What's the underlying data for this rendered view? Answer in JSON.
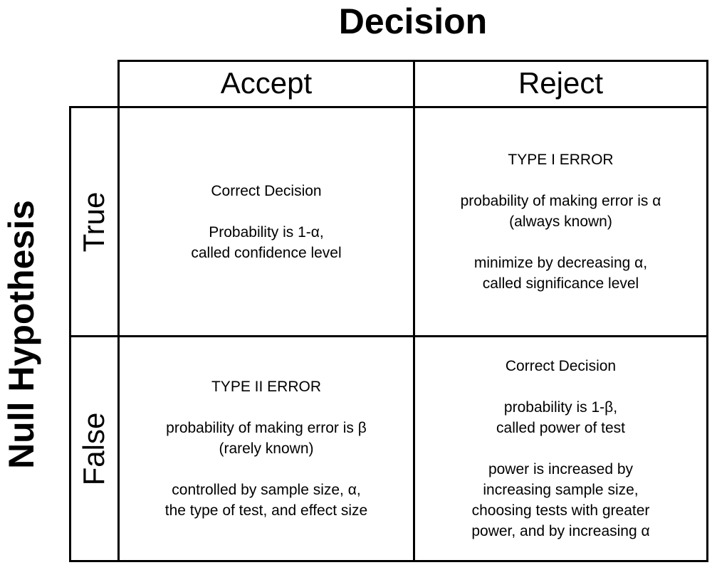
{
  "title_top": "Decision",
  "title_side": "Null Hypothesis",
  "columns": [
    "Accept",
    "Reject"
  ],
  "rows": [
    "True",
    "False"
  ],
  "cells": {
    "true_accept": {
      "heading": "Correct Decision",
      "lines": [
        "Probability is 1-α,",
        "called confidence level"
      ]
    },
    "true_reject": {
      "heading": "TYPE I ERROR",
      "lines": [
        "probability of making error is α",
        "(always known)"
      ],
      "lines2": [
        "minimize by decreasing α,",
        "called significance level"
      ]
    },
    "false_accept": {
      "heading": "TYPE II ERROR",
      "lines": [
        "probability of making error is β",
        "(rarely known)"
      ],
      "lines2": [
        "controlled by sample size, α,",
        "the type of test, and effect size"
      ]
    },
    "false_reject": {
      "heading": "Correct Decision",
      "lines": [
        "probability is 1-β,",
        "called power of test"
      ],
      "lines2": [
        "power is increased by",
        "increasing sample size,",
        "choosing tests with greater",
        "power, and by increasing α"
      ]
    }
  }
}
